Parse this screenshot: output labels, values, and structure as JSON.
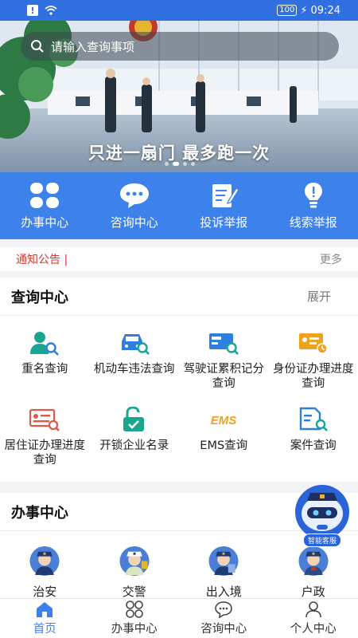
{
  "status_bar": {
    "time": "09:24",
    "battery": "100"
  },
  "search": {
    "placeholder": "请输入查询事项"
  },
  "banner": {
    "slogan": "只进一扇门 最多跑一次"
  },
  "quick_nav": [
    {
      "label": "办事中心",
      "icon": "grid-icon"
    },
    {
      "label": "咨询中心",
      "icon": "chat-bubble-icon"
    },
    {
      "label": "投诉举报",
      "icon": "edit-document-icon"
    },
    {
      "label": "线索举报",
      "icon": "lightbulb-icon"
    }
  ],
  "notice": {
    "label": "通知公告 |",
    "more": "更多"
  },
  "query_center": {
    "title": "查询中心",
    "action": "展开",
    "items": [
      {
        "label": "重名查询",
        "icon": "person-search-icon",
        "color": "#1aa591"
      },
      {
        "label": "机动车违法查询",
        "icon": "car-search-icon",
        "color": "#2f7fe0"
      },
      {
        "label": "驾驶证累积记分查询",
        "icon": "license-search-icon",
        "color": "#2f7fe0"
      },
      {
        "label": "身份证办理进度查询",
        "icon": "id-card-progress-icon",
        "color": "#f0a020"
      },
      {
        "label": "居住证办理进度查询",
        "icon": "residence-card-icon",
        "color": "#e2574c"
      },
      {
        "label": "开锁企业名录",
        "icon": "unlock-icon",
        "color": "#1aa591"
      },
      {
        "label": "EMS查询",
        "icon": "ems-icon",
        "color": "#f0a020"
      },
      {
        "label": "案件查询",
        "icon": "case-search-icon",
        "color": "#2f7fe0"
      }
    ]
  },
  "service_center": {
    "title": "办事中心",
    "items": [
      {
        "label": "治安",
        "icon": "police-officer-icon"
      },
      {
        "label": "交警",
        "icon": "traffic-police-icon"
      },
      {
        "label": "出入境",
        "icon": "immigration-officer-icon"
      },
      {
        "label": "户政",
        "icon": "household-officer-icon"
      }
    ]
  },
  "chatbot": {
    "tag": "智能客服"
  },
  "tab_bar": [
    {
      "label": "首页",
      "icon": "home-icon",
      "active": true
    },
    {
      "label": "办事中心",
      "icon": "grid-outline-icon",
      "active": false
    },
    {
      "label": "咨询中心",
      "icon": "chat-outline-icon",
      "active": false
    },
    {
      "label": "个人中心",
      "icon": "user-icon",
      "active": false
    }
  ],
  "colors": {
    "primary": "#3d82ea",
    "status_bar": "#2f6fe0",
    "notice_red": "#d9342b"
  }
}
